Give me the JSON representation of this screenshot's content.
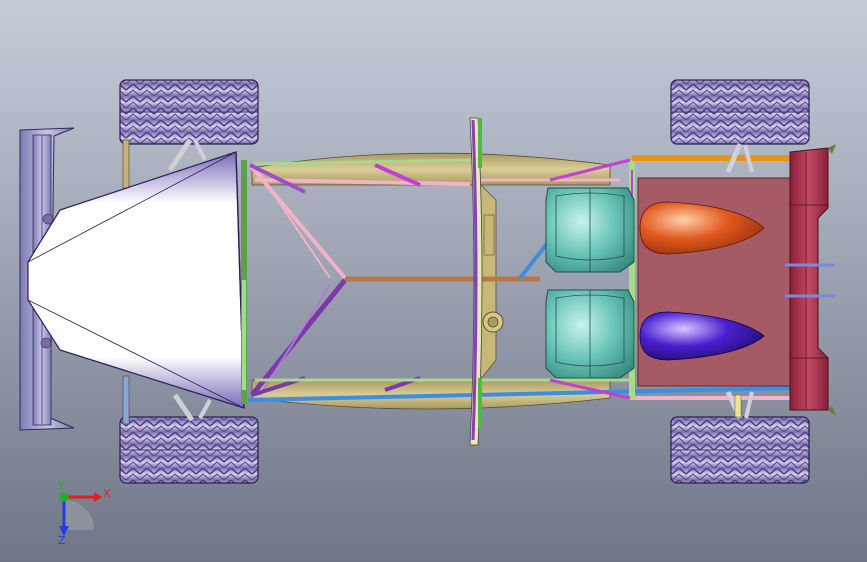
{
  "viewport": {
    "background_top": "#c6ccd8",
    "background_bottom": "#6f7687"
  },
  "colors": {
    "tire": "#9b8fc8",
    "tire_tread": "#6a5a9a",
    "wing": "#9d9dcc",
    "nose": "#f4f4f8",
    "floor": "#bfb07a",
    "rear_box": "#a55a66",
    "rear_wing": "#a23048",
    "seat": "#67c3b5",
    "tank_orange": "#e0521a",
    "tank_blue": "#4a1fd0",
    "tube_pink": "#f0b3c7",
    "tube_purple": "#8a3fb8",
    "tube_brown": "#b7774d",
    "tube_blue": "#3b8ee0",
    "tube_orange": "#e8921a",
    "tube_green": "#4fba3c",
    "tube_magenta": "#c43fd8",
    "tube_yellow": "#e8e88a"
  },
  "triad": {
    "x_label": "X",
    "y_label": "Y",
    "z_label": "Z",
    "x_color": "#e02020",
    "y_color": "#20b020",
    "z_color": "#2040e0"
  }
}
